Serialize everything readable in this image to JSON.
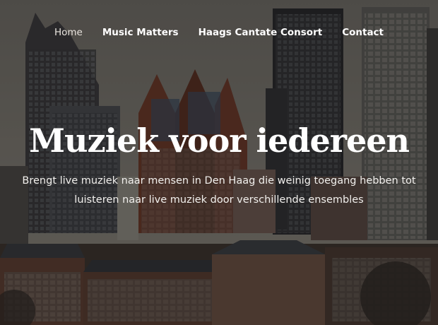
{
  "nav": {
    "items": [
      {
        "label": "Home",
        "active": true
      },
      {
        "label": "Music Matters",
        "active": false
      },
      {
        "label": "Haags Cantate Consort",
        "active": false
      },
      {
        "label": "Contact",
        "active": false
      }
    ]
  },
  "hero": {
    "title": "Muziek voor iedereen",
    "subtitle": "Brengt live muziek naar mensen in Den Haag die weinig toegang hebben tot luisteren naar live muziek door verschillende ensembles"
  },
  "colors": {
    "text": "#ffffff",
    "overlay": "#000000",
    "sky": "#7e7a72",
    "tower_dark": "#2b2b2e",
    "brick": "#6b3a2a"
  }
}
